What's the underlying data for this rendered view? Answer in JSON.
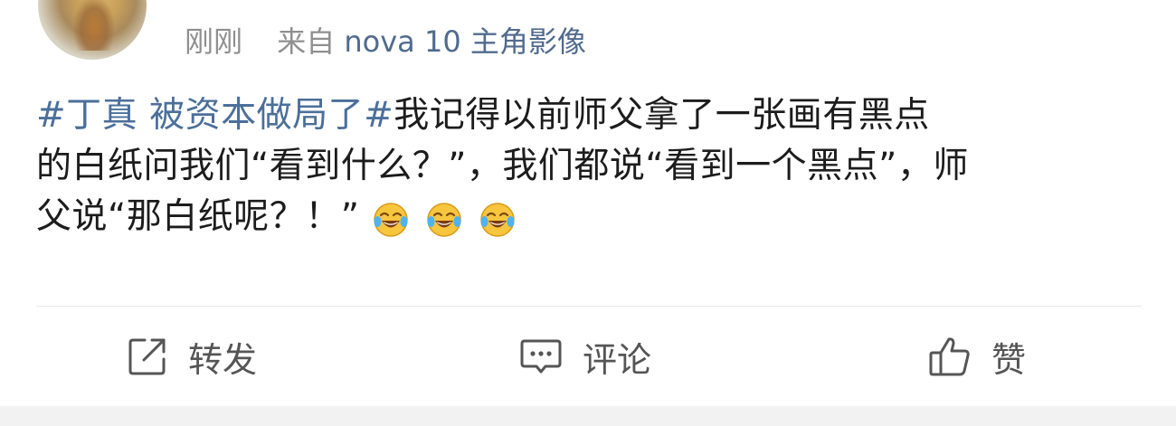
{
  "post": {
    "time": "刚刚",
    "source_prefix": "来自",
    "source_device": "nova 10 主角影像",
    "topic": "#丁真 被资本做局了#",
    "line1_rest": "我记得以前师父拿了一张画有黑点",
    "line2": "的白纸问我们“看到什么？”，我们都说“看到一个黑点”，师",
    "line3": "父说“那白纸呢？！”"
  },
  "emojis": [
    "laughing-crying-icon",
    "laughing-crying-icon",
    "laughing-crying-icon"
  ],
  "actions": {
    "repost_label": "转发",
    "comment_label": "评论",
    "like_label": "赞"
  },
  "colors": {
    "topic": "#4b6f9a",
    "device": "#506b8e",
    "meta": "#8f8f8f",
    "emoji_face": "#f7c53e"
  }
}
